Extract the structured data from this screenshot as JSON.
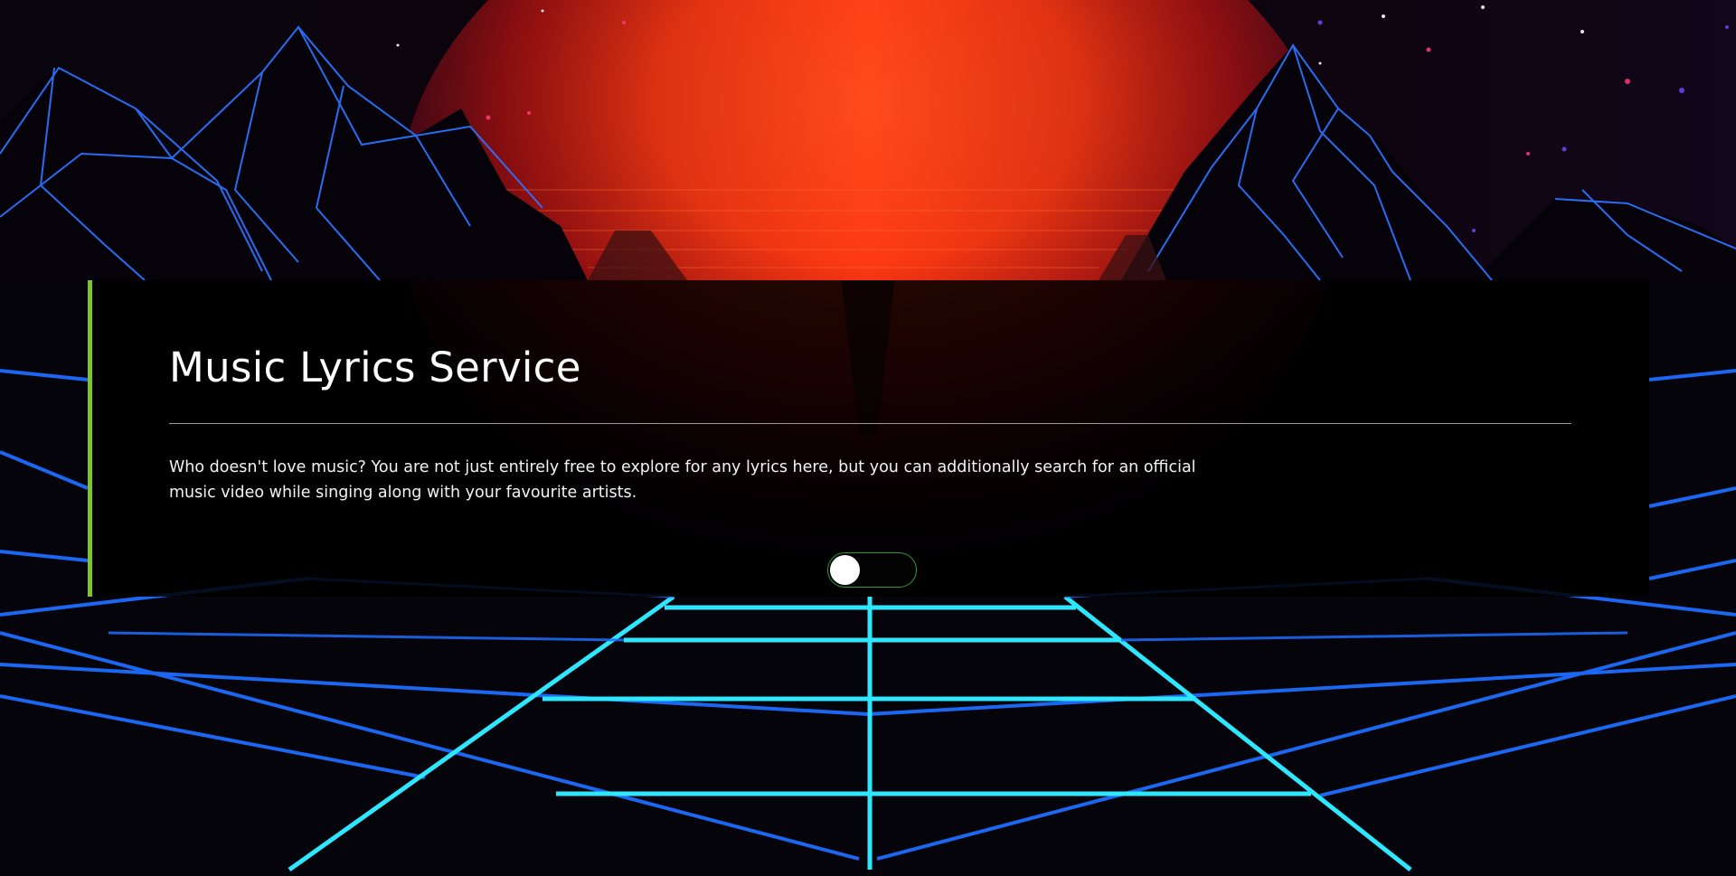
{
  "hero": {
    "title": "Music Lyrics Service",
    "description": "Who doesn't love music? You are not just entirely free to explore for any lyrics here, but you can additionally search for an official music video while singing along with your favourite artists."
  },
  "toggle": {
    "state": "off"
  },
  "colors": {
    "accent_bar": "#7cc52b",
    "toggle_border": "#2f9b2f",
    "grid_cyan": "#28c8ff",
    "grid_blue": "#1e6dff",
    "sun_red": "#ff3a12"
  }
}
